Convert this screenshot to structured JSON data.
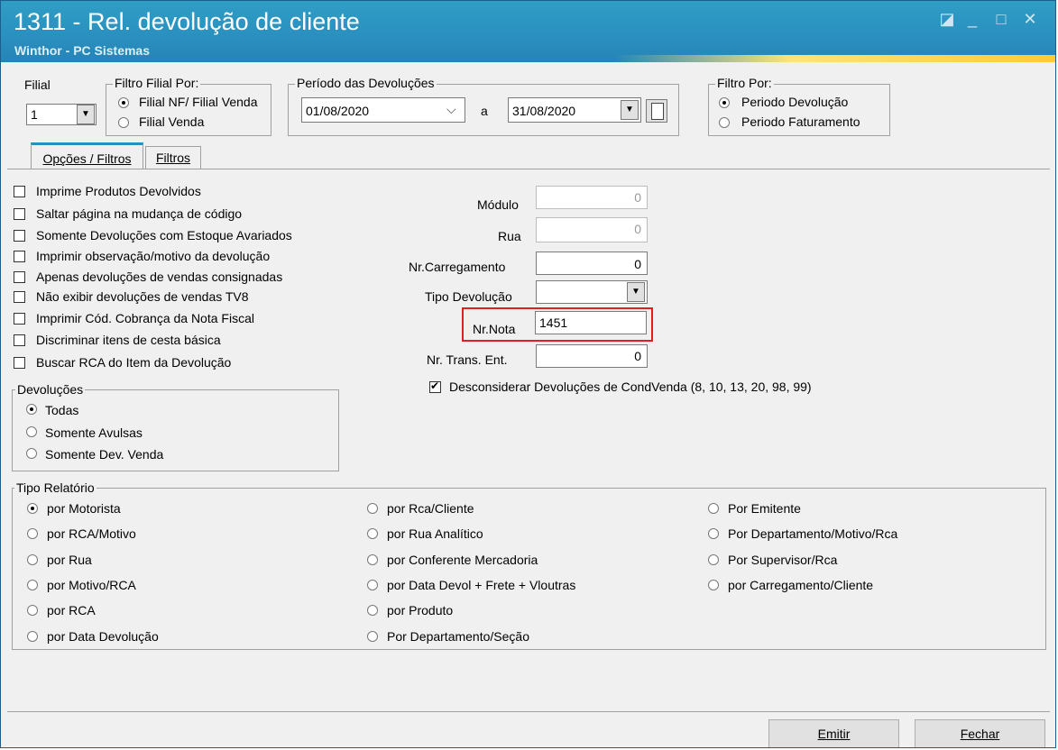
{
  "window": {
    "title": "1311 - Rel. devolução de cliente",
    "subtitle": "Winthor - PC Sistemas",
    "controls": {
      "restore": "◪",
      "minimize": "_",
      "maximize": "□",
      "close": "✕"
    }
  },
  "filial": {
    "label": "Filial",
    "value": "1"
  },
  "filtro_filial": {
    "legend": "Filtro Filial Por:",
    "options": [
      "Filial NF/ Filial Venda",
      "Filial Venda"
    ],
    "selected": 0
  },
  "periodo": {
    "legend": "Período das Devoluções",
    "start": "01/08/2020",
    "separator": "a",
    "end": "31/08/2020"
  },
  "filtro_por": {
    "legend": "Filtro Por:",
    "options": [
      "Periodo Devolução",
      "Periodo Faturamento"
    ],
    "selected": 0
  },
  "tabs": [
    "Opções / Filtros",
    "Filtros"
  ],
  "checkboxes": [
    {
      "label": "Imprime Produtos Devolvidos",
      "checked": false
    },
    {
      "label": "Saltar página na mudança de código",
      "checked": false
    },
    {
      "label": "Somente Devoluções com Estoque Avariados",
      "checked": false
    },
    {
      "label": "Imprimir observação/motivo da devolução",
      "checked": false
    },
    {
      "label": "Apenas devoluções de vendas consignadas",
      "checked": false
    },
    {
      "label": "Não exibir devoluções de vendas TV8",
      "checked": false
    },
    {
      "label": "Imprimir Cód. Cobrança da Nota Fiscal",
      "checked": false
    },
    {
      "label": "Discriminar itens de cesta básica",
      "checked": false
    },
    {
      "label": "Buscar RCA do Item da Devolução",
      "checked": false
    }
  ],
  "fields": {
    "modulo": {
      "label": "Módulo",
      "value": "0"
    },
    "rua": {
      "label": "Rua",
      "value": "0"
    },
    "carregamento": {
      "label": "Nr.Carregamento",
      "value": "0"
    },
    "tipo_devolucao": {
      "label": "Tipo Devolução",
      "value": ""
    },
    "nota": {
      "label": "Nr.Nota",
      "value": "1451"
    },
    "trans_ent": {
      "label": "Nr. Trans. Ent.",
      "value": "0"
    }
  },
  "desconsiderar": {
    "label": "Desconsiderar  Devoluções de CondVenda (8, 10, 13, 20, 98, 99)",
    "checked": true
  },
  "devolucoes": {
    "legend": "Devoluções",
    "options": [
      "Todas",
      "Somente Avulsas",
      "Somente Dev. Venda"
    ],
    "selected": 0
  },
  "tipo_relatorio": {
    "legend": "Tipo Relatório",
    "col1": [
      "por Motorista",
      "por RCA/Motivo",
      "por Rua",
      "por Motivo/RCA",
      "por RCA",
      "por Data Devolução"
    ],
    "col2": [
      "por Rca/Cliente",
      "por Rua Analítico",
      "por Conferente Mercadoria",
      "por Data Devol + Frete + Vloutras",
      "por Produto",
      "Por Departamento/Seção"
    ],
    "col3": [
      "Por Emitente",
      "Por Departamento/Motivo/Rca",
      "Por Supervisor/Rca",
      "por Carregamento/Cliente"
    ],
    "selected": "por Motorista"
  },
  "buttons": {
    "emitir": "Emitir",
    "fechar": "Fechar"
  },
  "colors": {
    "titlebar": "#2a8fbf",
    "highlight": "#e02020"
  }
}
